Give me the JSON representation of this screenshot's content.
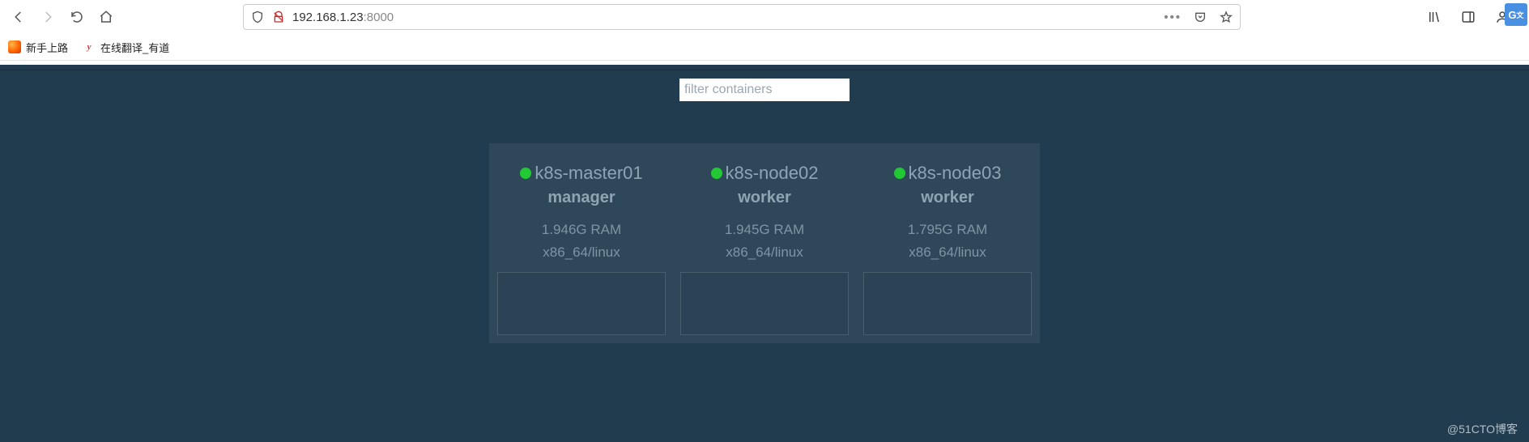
{
  "browser": {
    "url_host": "192.168.1.23",
    "url_port": ":8000",
    "bookmarks": [
      {
        "label": "新手上路",
        "icon": "firefox"
      },
      {
        "label": "在线翻译_有道",
        "icon": "youdao"
      }
    ]
  },
  "app": {
    "filter_placeholder": "filter containers",
    "nodes": [
      {
        "name": "k8s-master01",
        "role": "manager",
        "ram": "1.946G RAM",
        "arch": "x86_64/linux",
        "status": "up"
      },
      {
        "name": "k8s-node02",
        "role": "worker",
        "ram": "1.945G RAM",
        "arch": "x86_64/linux",
        "status": "up"
      },
      {
        "name": "k8s-node03",
        "role": "worker",
        "ram": "1.795G RAM",
        "arch": "x86_64/linux",
        "status": "up"
      }
    ],
    "watermark": "@51CTO博客"
  }
}
